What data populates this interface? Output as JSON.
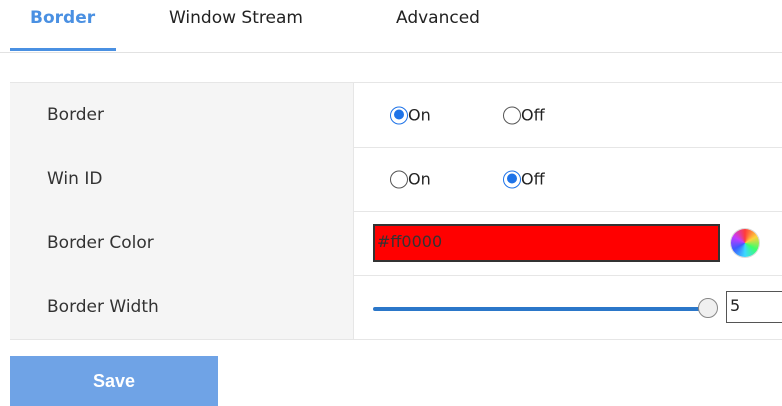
{
  "tabs": [
    {
      "label": "Border",
      "active": true
    },
    {
      "label": "Window Stream",
      "active": false
    },
    {
      "label": "Advanced",
      "active": false
    }
  ],
  "settings": {
    "border": {
      "label": "Border",
      "on_label": "On",
      "off_label": "Off",
      "selected": "On"
    },
    "win_id": {
      "label": "Win ID",
      "on_label": "On",
      "off_label": "Off",
      "selected": "Off"
    },
    "border_color": {
      "label": "Border Color",
      "value": "#ff0000",
      "swatch": "#ff0000",
      "icon": "color-palette-icon"
    },
    "border_width": {
      "label": "Border Width",
      "value": "5",
      "slider_fraction": 1.0
    }
  },
  "actions": {
    "save_label": "Save"
  },
  "colors": {
    "accent": "#4a90e2",
    "radio": "#1e73e8",
    "save_button": "#6fa3e6"
  }
}
